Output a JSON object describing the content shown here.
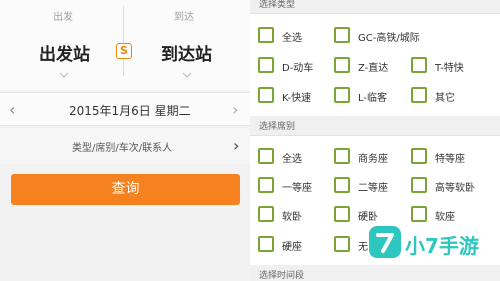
{
  "search": {
    "from_label": "出发",
    "to_label": "到达",
    "from_station": "出发站",
    "to_station": "到达站",
    "swap_symbol": "S",
    "date": "2015年1月6日 星期二",
    "filter": "类型/席别/车次/联系人",
    "query_button": "查询"
  },
  "filters": {
    "type_title": "选择类型",
    "types": [
      "全选",
      "GC-高铁/城际",
      "D-动车",
      "Z-直达",
      "T-特快",
      "K-快速",
      "L-临客",
      "其它"
    ],
    "seat_title": "选择席别",
    "seats": [
      "全选",
      "商务座",
      "特等座",
      "一等座",
      "二等座",
      "高等软卧",
      "软卧",
      "硬卧",
      "软座",
      "硬座",
      "无"
    ],
    "time_title": "选择时间段"
  },
  "watermark": {
    "text": "小7手游",
    "badge": "7"
  },
  "colors": {
    "accent_orange": "#f5821f",
    "checkbox_green": "#7aa434",
    "watermark_teal": "#2ec7c0"
  }
}
